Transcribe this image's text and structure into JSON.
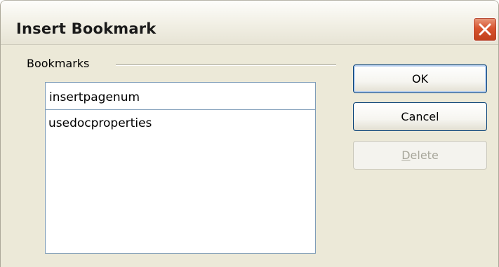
{
  "window": {
    "title": "Insert Bookmark"
  },
  "bookmarks": {
    "group_label": "Bookmarks",
    "name_input_value": "insertpagenum",
    "list_items": [
      "usedocproperties"
    ]
  },
  "buttons": {
    "ok_label": "OK",
    "cancel_label": "Cancel",
    "delete_mnemonic": "D",
    "delete_rest": "elete"
  },
  "icons": {
    "close": "close-icon"
  },
  "colors": {
    "close_button": "#d8542f",
    "dialog_background": "#ece9d8",
    "field_border": "#7f9db9",
    "default_button_border": "#003c74"
  }
}
